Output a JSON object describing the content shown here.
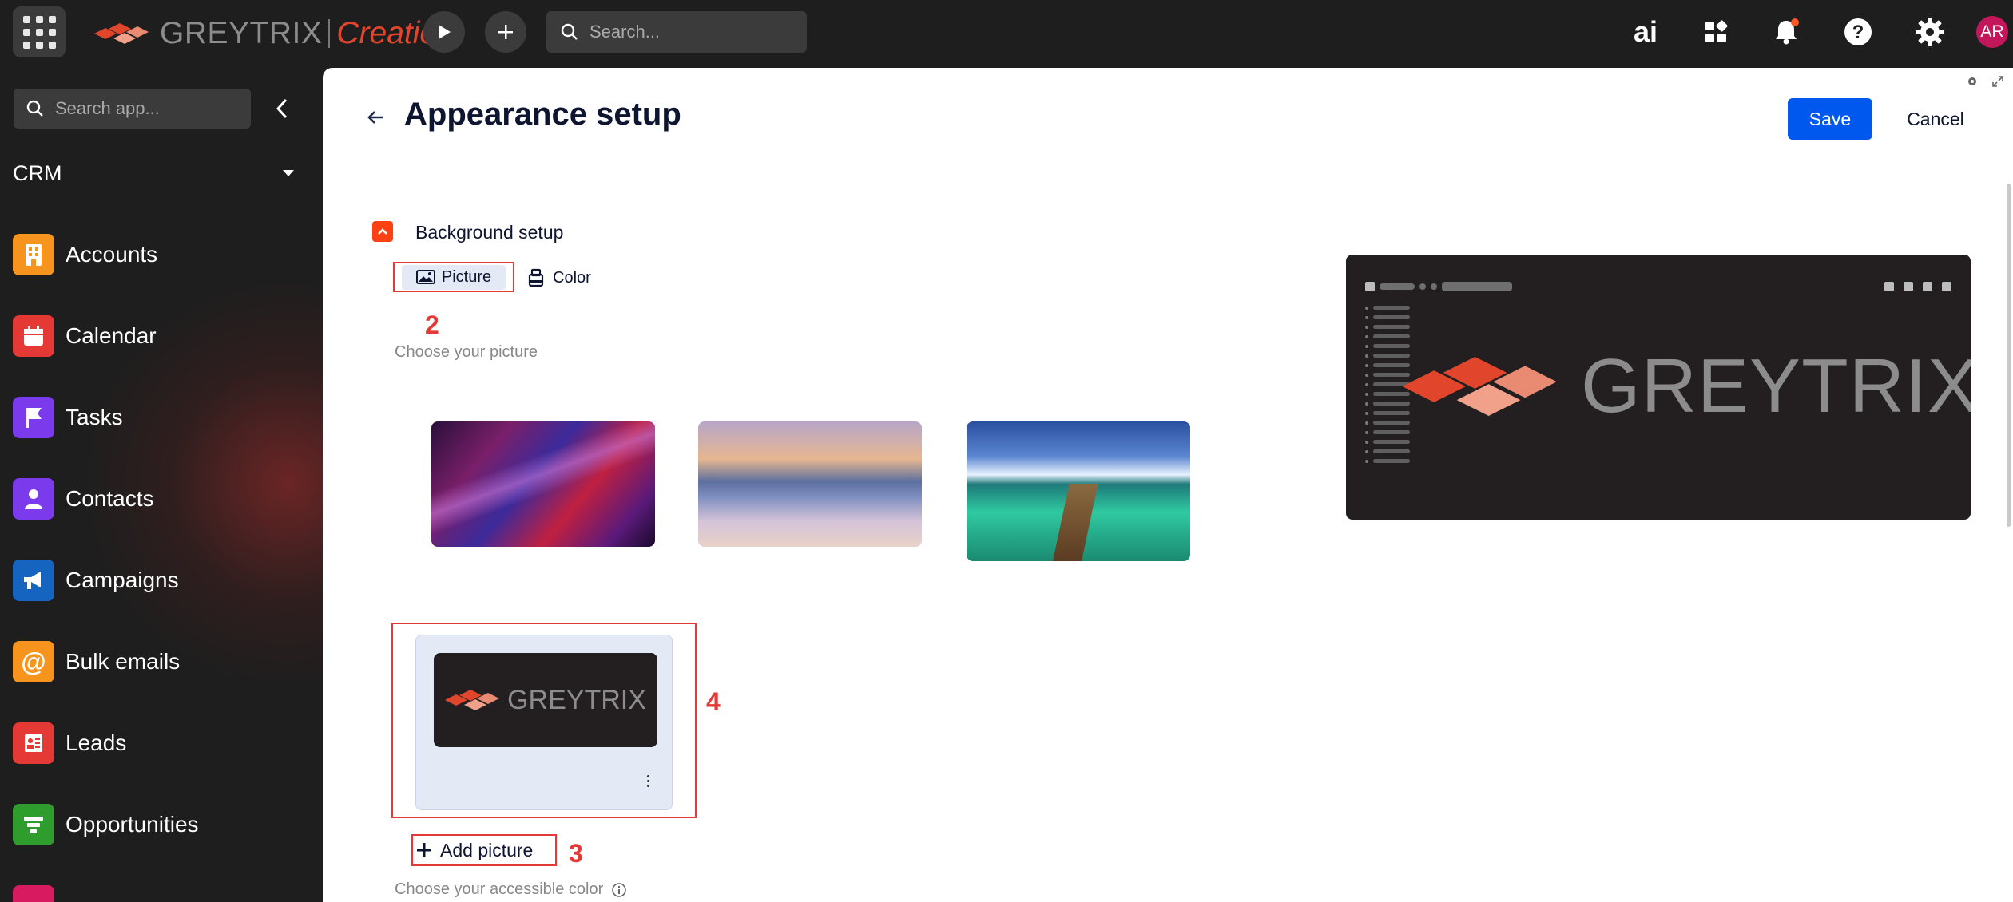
{
  "topbar": {
    "brand_name": "GREYTRIX",
    "brand_product": "Creatio",
    "search_placeholder": "Search...",
    "ai_label": "ai",
    "avatar_initials": "AR",
    "notification_dot_color": "#ff5722"
  },
  "sidebar": {
    "search_placeholder": "Search app...",
    "workspace": "CRM",
    "items": [
      {
        "label": "Accounts",
        "icon": "building-icon",
        "color": "#f7941d"
      },
      {
        "label": "Calendar",
        "icon": "calendar-icon",
        "color": "#e53935"
      },
      {
        "label": "Tasks",
        "icon": "flag-icon",
        "color": "#7c3aed"
      },
      {
        "label": "Contacts",
        "icon": "person-icon",
        "color": "#7c3aed"
      },
      {
        "label": "Campaigns",
        "icon": "megaphone-icon",
        "color": "#1565c0"
      },
      {
        "label": "Bulk emails",
        "icon": "at-sign-icon",
        "color": "#f7941d"
      },
      {
        "label": "Leads",
        "icon": "lead-card-icon",
        "color": "#e53935"
      },
      {
        "label": "Opportunities",
        "icon": "funnel-icon",
        "color": "#2e9d2e"
      }
    ]
  },
  "page": {
    "title": "Appearance setup",
    "save_label": "Save",
    "cancel_label": "Cancel",
    "accent_color": "#0058ef"
  },
  "background_setup": {
    "section_title": "Background setup",
    "tabs": {
      "picture": "Picture",
      "color": "Color"
    },
    "choose_picture_label": "Choose your picture",
    "pictures": [
      {
        "name": "abstract-waves"
      },
      {
        "name": "misty-mountains"
      },
      {
        "name": "tropical-pier"
      }
    ],
    "selected_picture_brand": "GREYTRIX",
    "add_picture_label": "Add picture",
    "choose_color_label": "Choose your accessible color"
  },
  "annotations": {
    "tab": "2",
    "add_picture": "3",
    "selected_picture": "4",
    "color": "#e53935"
  },
  "preview": {
    "brand_name": "GREYTRIX"
  }
}
